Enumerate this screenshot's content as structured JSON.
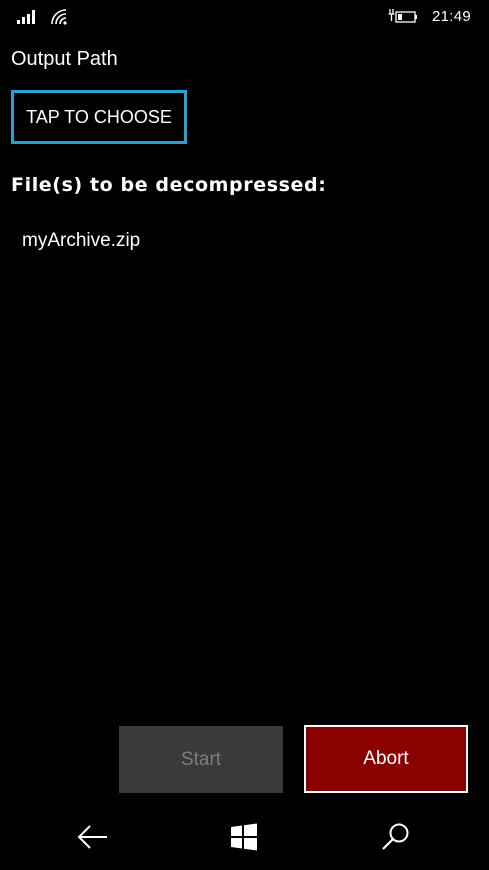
{
  "status_bar": {
    "time": "21:49",
    "icons": [
      "signal-icon",
      "wifi-icon",
      "battery-charging-icon"
    ]
  },
  "output": {
    "label": "Output Path",
    "choose_button": "TAP TO CHOOSE"
  },
  "files": {
    "heading": "File(s) to be decompressed:",
    "items": [
      "myArchive.zip"
    ]
  },
  "actions": {
    "start_label": "Start",
    "abort_label": "Abort",
    "abort_color": "#8b0000",
    "accent_color": "#2a9fd6"
  },
  "nav_bar": {
    "icons": [
      "back-icon",
      "windows-icon",
      "search-icon"
    ]
  }
}
